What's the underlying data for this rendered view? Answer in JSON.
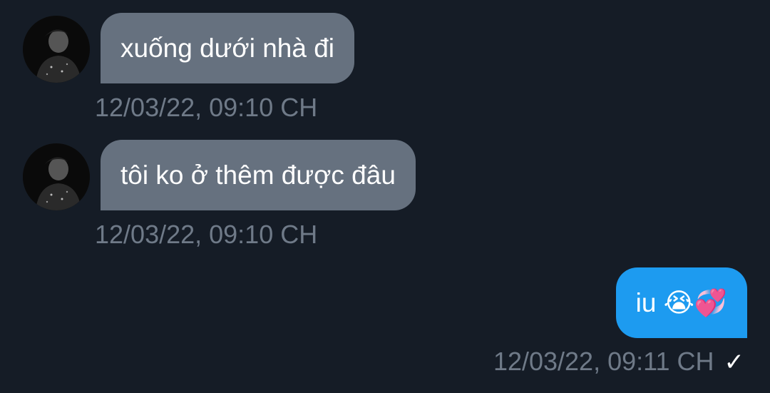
{
  "messages": [
    {
      "direction": "incoming",
      "text": "xuống dưới nhà đi",
      "timestamp": "12/03/22, 09:10 CH",
      "avatar_icon": "user-avatar"
    },
    {
      "direction": "incoming",
      "text": "tôi ko ở thêm được đâu",
      "timestamp": "12/03/22, 09:10 CH",
      "avatar_icon": "user-avatar"
    },
    {
      "direction": "outgoing",
      "text": "iu 😭💞",
      "timestamp": "12/03/22, 09:11 CH",
      "status_icon": "check-icon",
      "status_glyph": "✓"
    }
  ],
  "colors": {
    "background": "#151c26",
    "incoming_bubble": "#66717f",
    "outgoing_bubble": "#1d9bf0",
    "timestamp": "#6f7a88"
  }
}
